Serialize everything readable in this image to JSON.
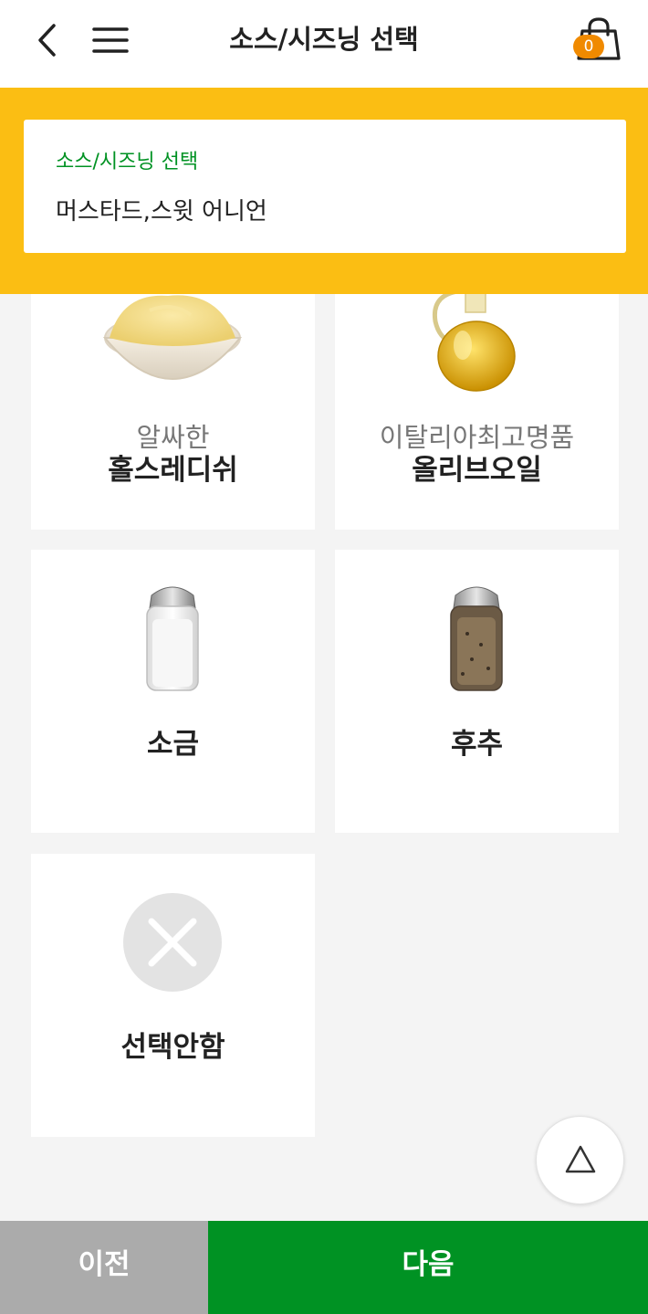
{
  "header": {
    "title": "소스/시즈닝 선택",
    "cart_count": "0",
    "back_icon": "chevron-left-icon",
    "menu_icon": "hamburger-menu-icon",
    "cart_icon": "shopping-bag-icon"
  },
  "summary": {
    "label": "소스/시즈닝 선택",
    "value": "머스타드,스윗 어니언"
  },
  "options": [
    {
      "subtitle": "알싸한",
      "name": "홀스레디쉬"
    },
    {
      "subtitle": "이탈리아최고명품",
      "name": "올리브오일"
    },
    {
      "subtitle": "",
      "name": "소금"
    },
    {
      "subtitle": "",
      "name": "후추"
    },
    {
      "subtitle": "",
      "name": "선택안함"
    }
  ],
  "footer": {
    "prev_label": "이전",
    "next_label": "다음"
  },
  "colors": {
    "accent_green": "#009223",
    "band_yellow": "#fbbe13",
    "badge_orange": "#f08a00",
    "prev_gray": "#ababab"
  }
}
